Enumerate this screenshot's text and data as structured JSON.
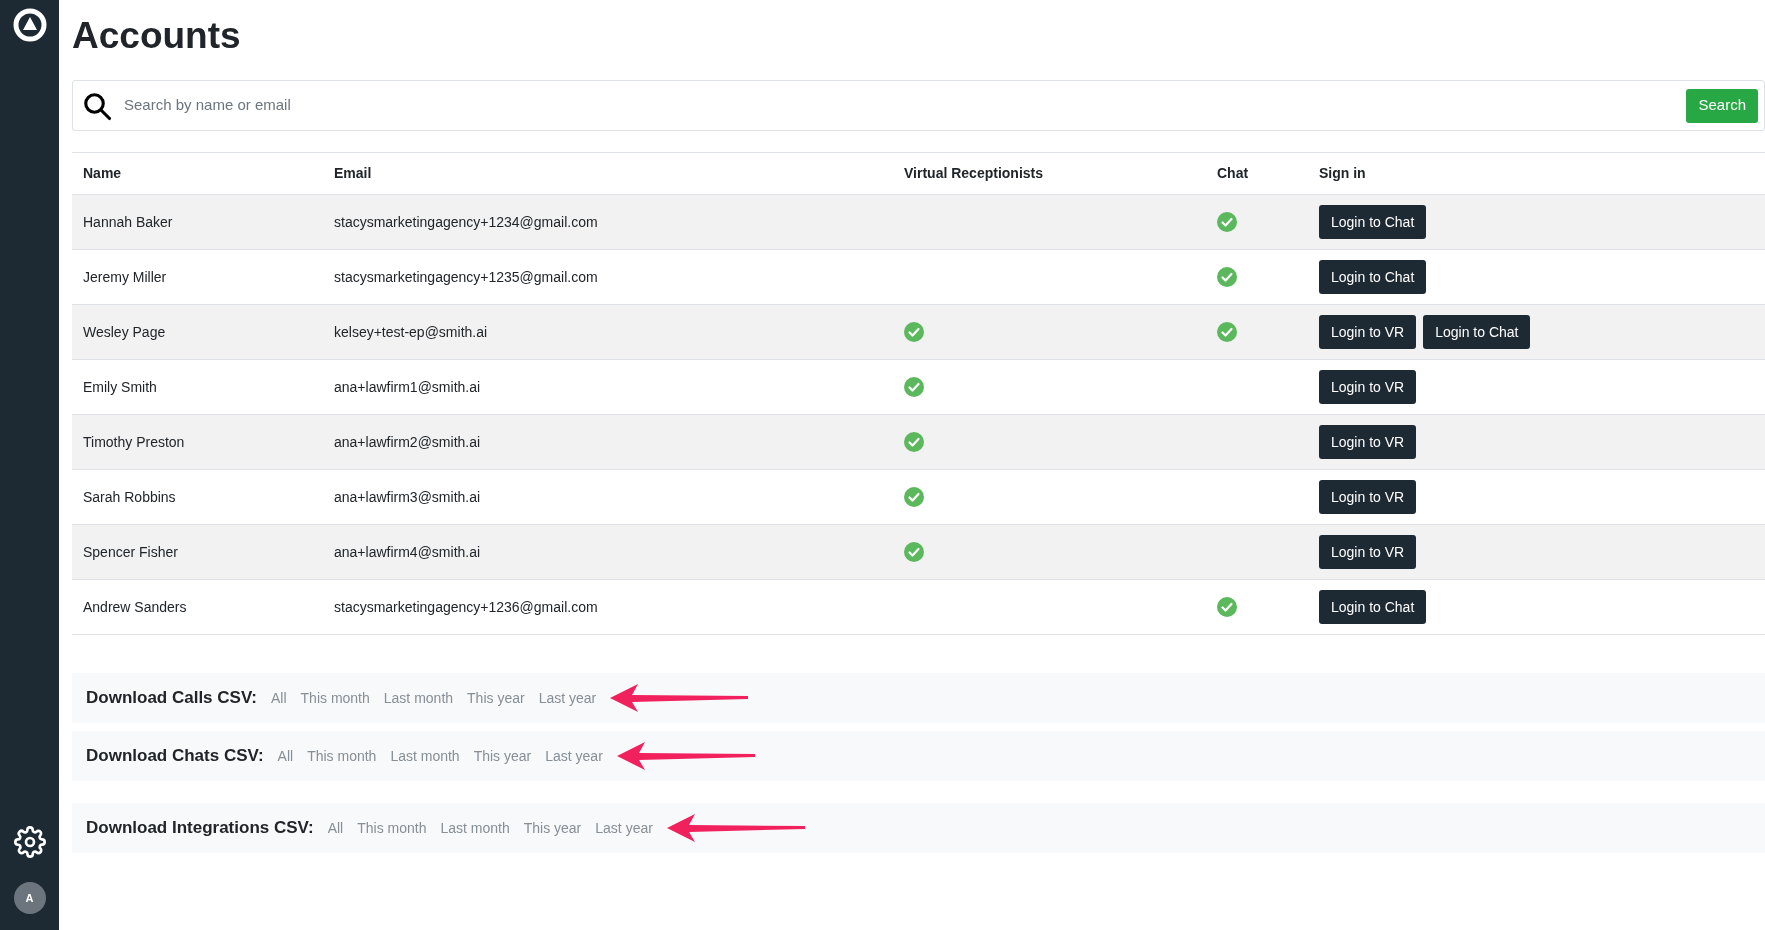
{
  "title": "Accounts",
  "search": {
    "placeholder": "Search by name or email",
    "button": "Search"
  },
  "table": {
    "columns": [
      "Name",
      "Email",
      "Virtual Receptionists",
      "Chat",
      "Sign in"
    ],
    "rows": [
      {
        "name": "Hannah Baker",
        "email": "stacysmarketingagency+1234@gmail.com",
        "vr": false,
        "chat": true,
        "buttons": [
          "Login to Chat"
        ]
      },
      {
        "name": "Jeremy Miller",
        "email": "stacysmarketingagency+1235@gmail.com",
        "vr": false,
        "chat": true,
        "buttons": [
          "Login to Chat"
        ]
      },
      {
        "name": "Wesley Page",
        "email": "kelsey+test-ep@smith.ai",
        "vr": true,
        "chat": true,
        "buttons": [
          "Login to VR",
          "Login to Chat"
        ]
      },
      {
        "name": "Emily Smith",
        "email": "ana+lawfirm1@smith.ai",
        "vr": true,
        "chat": false,
        "buttons": [
          "Login to VR"
        ]
      },
      {
        "name": "Timothy Preston",
        "email": "ana+lawfirm2@smith.ai",
        "vr": true,
        "chat": false,
        "buttons": [
          "Login to VR"
        ]
      },
      {
        "name": "Sarah Robbins",
        "email": "ana+lawfirm3@smith.ai",
        "vr": true,
        "chat": false,
        "buttons": [
          "Login to VR"
        ]
      },
      {
        "name": "Spencer Fisher",
        "email": "ana+lawfirm4@smith.ai",
        "vr": true,
        "chat": false,
        "buttons": [
          "Login to VR"
        ]
      },
      {
        "name": "Andrew Sanders",
        "email": "stacysmarketingagency+1236@gmail.com",
        "vr": false,
        "chat": true,
        "buttons": [
          "Login to Chat"
        ]
      }
    ]
  },
  "downloads": [
    {
      "label": "Download Calls CSV:",
      "links": [
        "All",
        "This month",
        "Last month",
        "This year",
        "Last year"
      ],
      "arrow": true
    },
    {
      "label": "Download Chats CSV:",
      "links": [
        "All",
        "This month",
        "Last month",
        "This year",
        "Last year"
      ],
      "arrow": true
    },
    {
      "label": "Download Integrations CSV:",
      "links": [
        "All",
        "This month",
        "Last month",
        "This year",
        "Last year"
      ],
      "arrow": true
    }
  ],
  "sidebar": {
    "avatar": "A"
  }
}
